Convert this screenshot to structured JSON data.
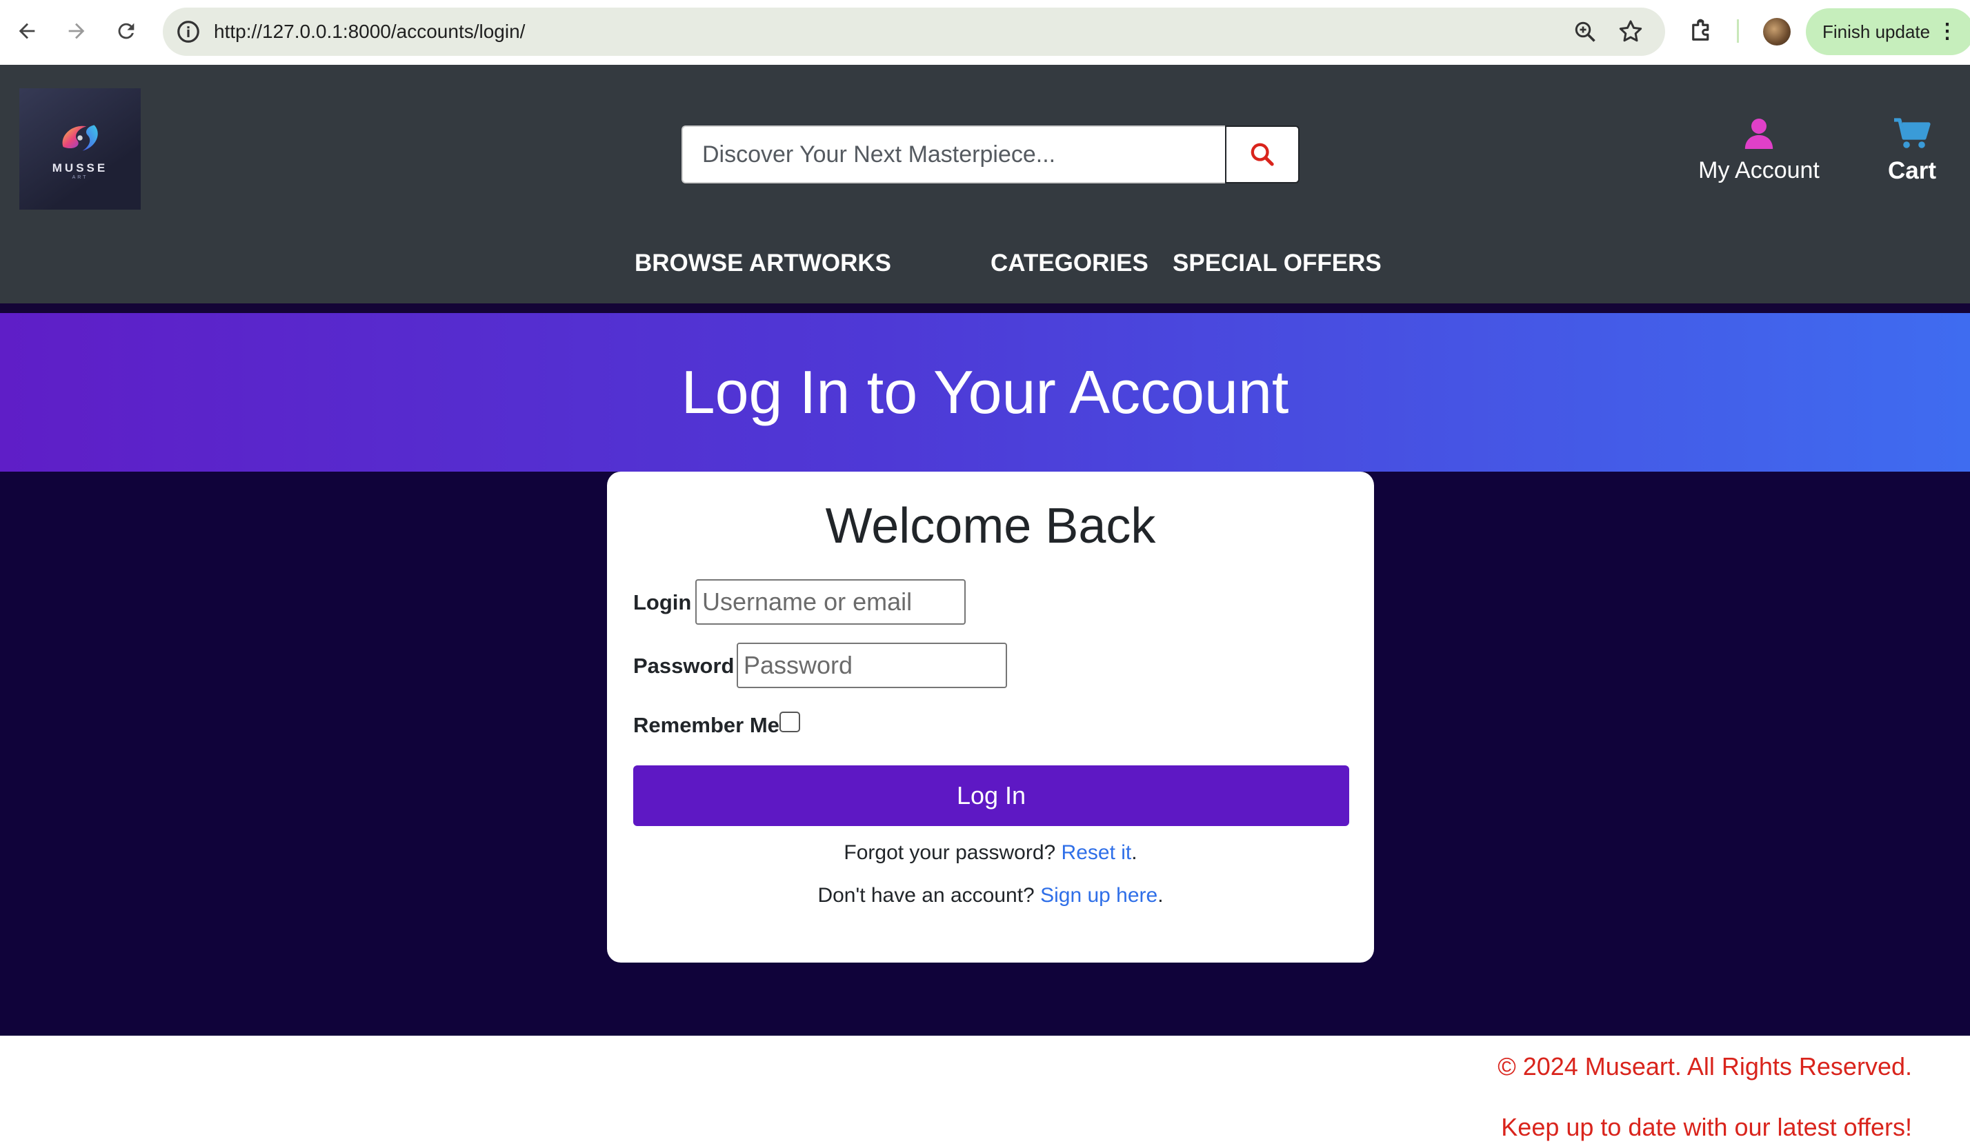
{
  "browser": {
    "url": "http://127.0.0.1:8000/accounts/login/",
    "update_label": "Finish update",
    "update_menu": "⋮"
  },
  "header": {
    "logo": {
      "text": "MUSSE",
      "sub": "ART"
    },
    "search": {
      "placeholder": "Discover Your Next Masterpiece..."
    },
    "account_label": "My Account",
    "cart_label": "Cart",
    "nav": {
      "browse": "BROWSE ARTWORKS",
      "categories": "CATEGORIES",
      "offers": "SPECIAL OFFERS"
    },
    "colors": {
      "background": "#343a40",
      "account_icon": "#e040c8",
      "cart_icon": "#3a9bd8",
      "search_icon": "#d9241c"
    }
  },
  "hero": {
    "title": "Log In to Your Account"
  },
  "login_form": {
    "heading": "Welcome Back",
    "login_label": "Login",
    "login_placeholder": "Username or email",
    "password_label": "Password",
    "password_placeholder": "Password",
    "remember_label": "Remember Me",
    "remember_checked": false,
    "submit_label": "Log In",
    "forgot_text": "Forgot your password?",
    "forgot_link": "Reset it",
    "forgot_suffix": ".",
    "signup_text": "Don't have an account?",
    "signup_link": "Sign up here",
    "signup_suffix": ".",
    "colors": {
      "button": "#5e18c4",
      "link": "#2f6fe8"
    }
  },
  "footer": {
    "copyright": "© 2024 Museart. All Rights Reserved.",
    "tagline": "Keep up to date with our latest offers!",
    "text_color": "#d9241c"
  }
}
